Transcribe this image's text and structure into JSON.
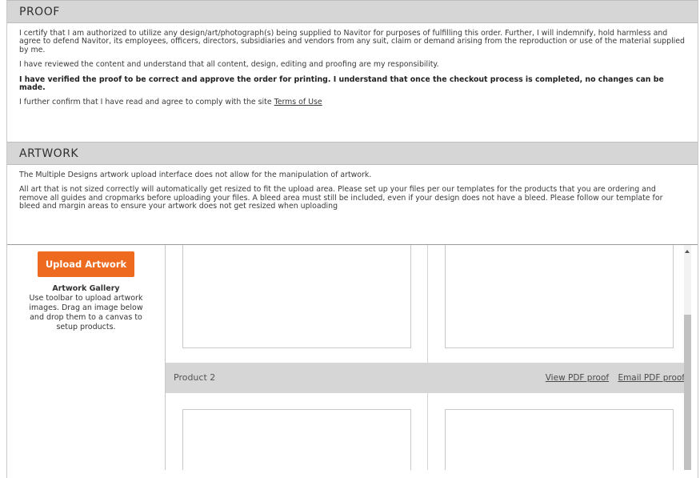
{
  "proof": {
    "title": "PROOF",
    "para1": "I certify that I am authorized to utilize any design/art/photograph(s) being supplied to Navitor for purposes of fulfilling this order. Further, I will indemnify, hold harmless and agree to defend Navitor, its employees, officers, directors, subsidiaries and vendors from any suit, claim or demand arising from the reproduction or use of the material supplied by me.",
    "para2": "I have reviewed the content and understand that all content, design, editing and proofing are my responsibility.",
    "para3": "I have verified the proof to be correct and approve the order for printing. I understand that once the checkout process is completed, no changes can be made.",
    "para4_prefix": "I further confirm that I have read and agree to comply with the site ",
    "terms_link": "Terms of Use"
  },
  "artwork": {
    "title": "ARTWORK",
    "para1": "The Multiple Designs artwork upload interface does not allow for the manipulation of artwork.",
    "para2": "All art that is not sized correctly will automatically get resized to fit the upload area. Please set up your files per our templates for the products that you are ordering and remove all guides and cropmarks before uploading your files. A bleed area must still be included, even if your design does not have a bleed. Please follow our template for bleed and margin areas to ensure your artwork does not get resized when uploading"
  },
  "gallery": {
    "upload_button": "Upload Artwork",
    "title": "Artwork Gallery",
    "description": "Use toolbar to upload artwork images. Drag an image below and drop them to a canvas to setup products."
  },
  "product": {
    "name": "Product 2",
    "view_pdf": "View PDF proof",
    "email_pdf": "Email PDF proof"
  },
  "colors": {
    "accent": "#ed6a1f",
    "header_bg": "#d6d6d6"
  },
  "icons": {
    "scroll_up": "triangle-up"
  }
}
